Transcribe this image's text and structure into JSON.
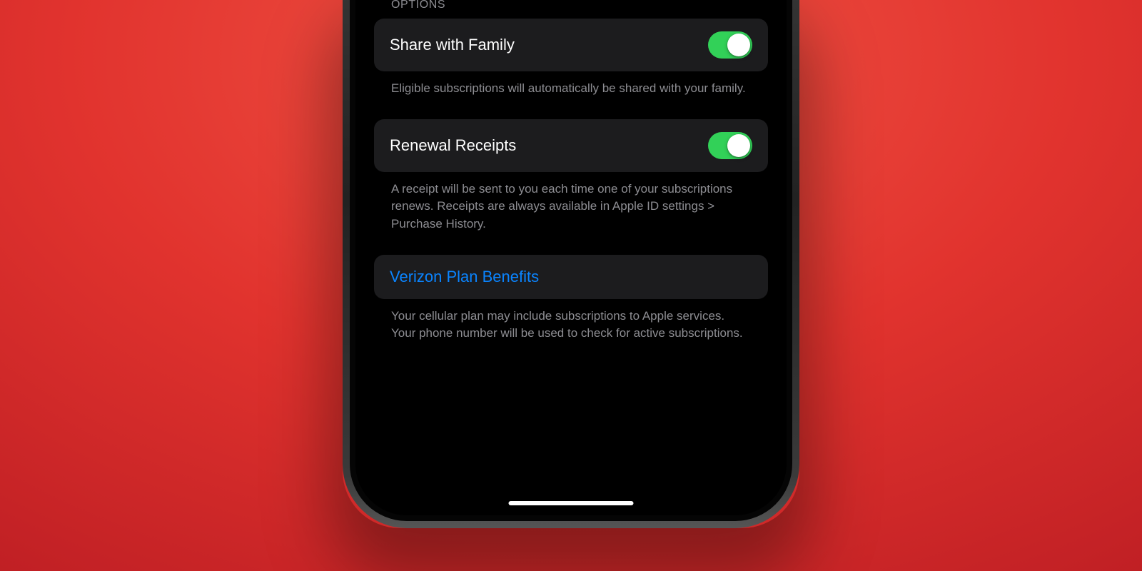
{
  "section_header": "OPTIONS",
  "options": {
    "share_family": {
      "label": "Share with Family",
      "footer": "Eligible subscriptions will automatically be shared with your family.",
      "on": true
    },
    "renewal_receipts": {
      "label": "Renewal Receipts",
      "footer": "A receipt will be sent to you each time one of your subscriptions renews. Receipts are always available in Apple ID settings > Purchase History.",
      "on": true
    }
  },
  "carrier_link": {
    "label": "Verizon Plan Benefits",
    "footer": "Your cellular plan may include subscriptions to Apple services. Your phone number will be used to check for active subscriptions."
  },
  "colors": {
    "toggle_on": "#32d158",
    "link": "#0a84ff",
    "cell_bg": "#1c1c1e"
  }
}
